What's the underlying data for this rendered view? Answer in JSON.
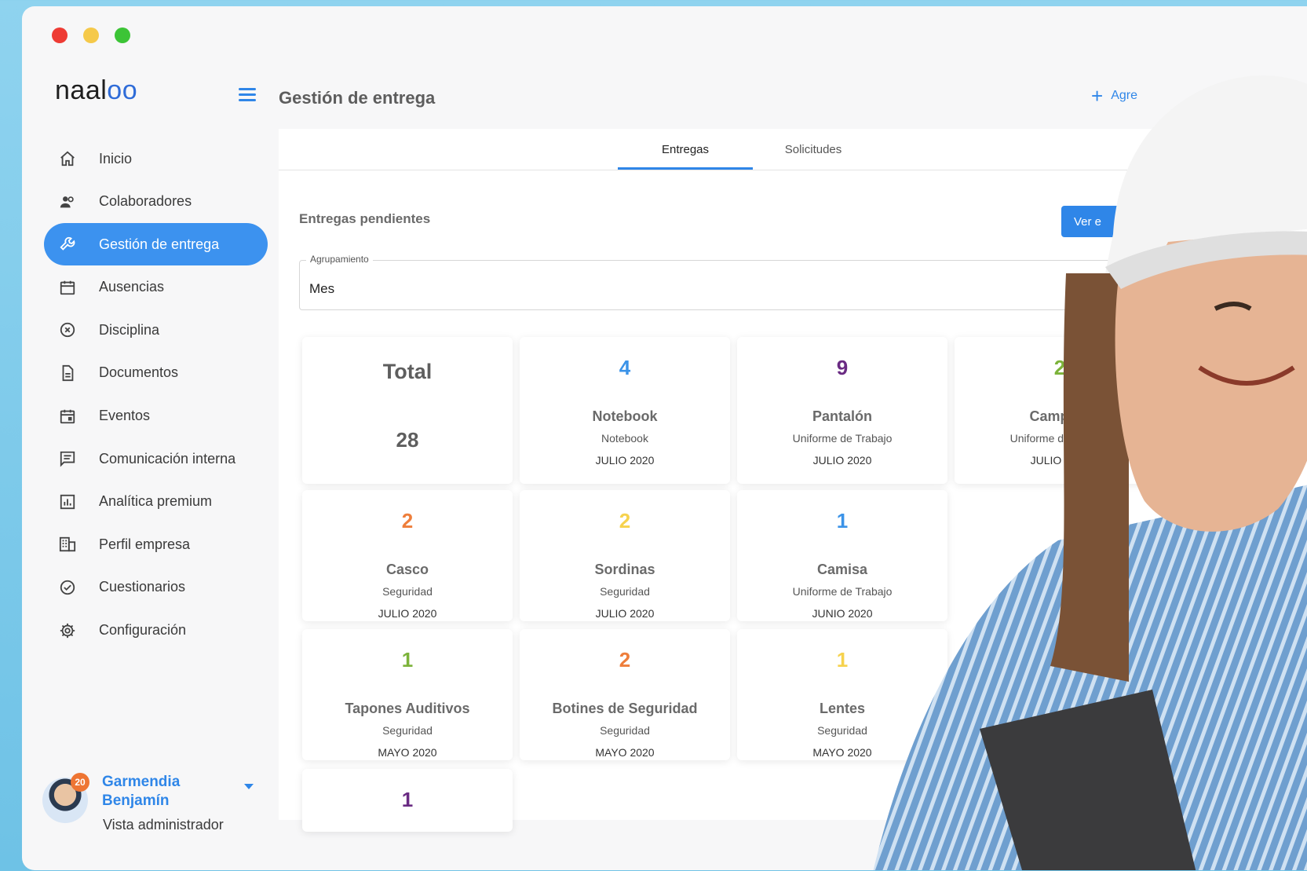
{
  "window": {
    "traffic_colors": [
      "#ee3b34",
      "#f5c94a",
      "#3cc436"
    ]
  },
  "sidebar": {
    "logo": {
      "text": "naal",
      "accent": "oo"
    },
    "items": [
      {
        "label": "Inicio",
        "icon": "home-icon"
      },
      {
        "label": "Colaboradores",
        "icon": "people-icon"
      },
      {
        "label": "Gestión de entrega",
        "icon": "wrench-icon",
        "active": true
      },
      {
        "label": "Ausencias",
        "icon": "calendar-icon"
      },
      {
        "label": "Disciplina",
        "icon": "x-circle-icon"
      },
      {
        "label": "Documentos",
        "icon": "document-icon"
      },
      {
        "label": "Eventos",
        "icon": "event-icon"
      },
      {
        "label": "Comunicación interna",
        "icon": "chat-icon"
      },
      {
        "label": "Analítica premium",
        "icon": "analytics-icon"
      },
      {
        "label": "Perfil empresa",
        "icon": "building-icon"
      },
      {
        "label": "Cuestionarios",
        "icon": "check-circle-icon"
      },
      {
        "label": "Configuración",
        "icon": "gear-icon"
      }
    ],
    "user": {
      "badge": "20",
      "name": "Garmendia Benjamín",
      "role": "Vista administrador"
    }
  },
  "header": {
    "title": "Gestión de entrega",
    "add_label": "Agre"
  },
  "tabs": [
    {
      "label": "Entregas",
      "active": true
    },
    {
      "label": "Solicitudes",
      "active": false
    }
  ],
  "pending": {
    "title": "Entregas pendientes",
    "button": "Ver e",
    "grouping": {
      "label": "Agrupamiento",
      "value": "Mes"
    }
  },
  "total": {
    "label": "Total",
    "value": "28"
  },
  "cards": [
    {
      "num": "4",
      "title": "Notebook",
      "category": "Notebook",
      "date": "JULIO 2020",
      "color": "#3b93e8"
    },
    {
      "num": "9",
      "title": "Pantalón",
      "category": "Uniforme de Trabajo",
      "date": "JULIO 2020",
      "color": "#6a2b83"
    },
    {
      "num": "2",
      "title": "Campera",
      "category": "Uniforme de Trabajo",
      "date": "JULIO 2020",
      "color": "#7cb33a"
    },
    {
      "num": "2",
      "title": "Casco",
      "category": "Seguridad",
      "date": "JULIO 2020",
      "color": "#ee7e3b"
    },
    {
      "num": "2",
      "title": "Sordinas",
      "category": "Seguridad",
      "date": "JULIO 2020",
      "color": "#f6d24d"
    },
    {
      "num": "1",
      "title": "Camisa",
      "category": "Uniforme de Trabajo",
      "date": "JUNIO 2020",
      "color": "#3b93e8"
    },
    {
      "num": "1",
      "title": "Tapones Auditivos",
      "category": "Seguridad",
      "date": "MAYO 2020",
      "color": "#7cb33a"
    },
    {
      "num": "2",
      "title": "Botines de Seguridad",
      "category": "Seguridad",
      "date": "MAYO 2020",
      "color": "#ee7e3b"
    },
    {
      "num": "1",
      "title": "Lentes",
      "category": "Seguridad",
      "date": "MAYO 2020",
      "color": "#f6d24d"
    },
    {
      "num": "1",
      "title": "",
      "category": "",
      "date": "",
      "color": "#6a2b83"
    }
  ]
}
